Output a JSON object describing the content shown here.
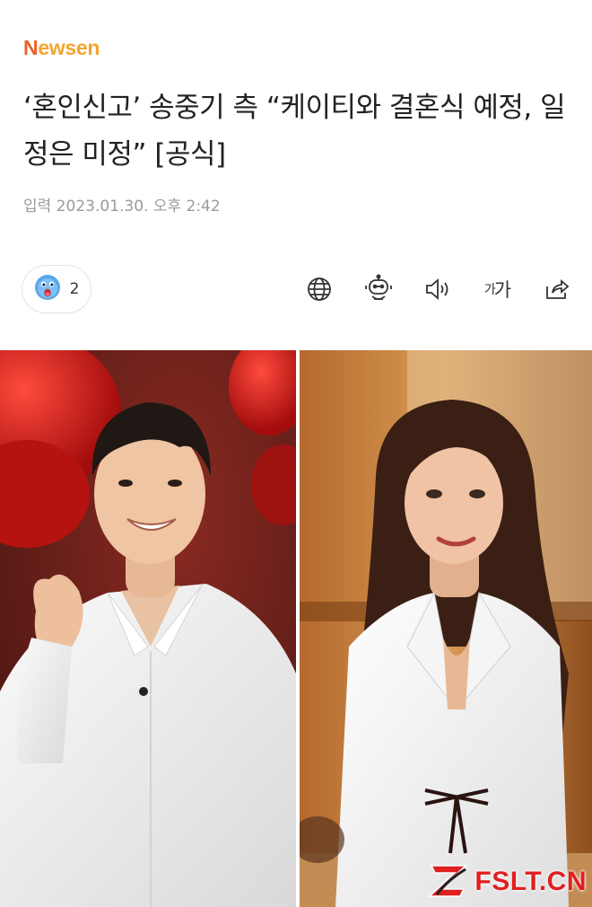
{
  "brand": {
    "logo_first": "N",
    "logo_rest": "ewsen",
    "colors": {
      "n": "#e8622b",
      "rest": "#f2a531"
    }
  },
  "article": {
    "headline": "‘혼인신고’ 송중기 측 “케이티와 결혼식 예정, 일정은 미정” [공식]",
    "dateline": "입력 2023.01.30. 오후 2:42"
  },
  "reaction": {
    "icon": "surprised-face-icon",
    "count": "2"
  },
  "toolbar": {
    "items": [
      "globe-icon",
      "robot-icon",
      "speaker-icon",
      "font-size-icon",
      "share-icon"
    ],
    "fontsize_small": "가",
    "fontsize_large": "가"
  },
  "images": {
    "left": "man-in-white-shirt-finger-heart-photo",
    "right": "woman-in-white-blouse-photo"
  },
  "watermark": {
    "text": "FSLT.CN",
    "color": "#e02020"
  }
}
